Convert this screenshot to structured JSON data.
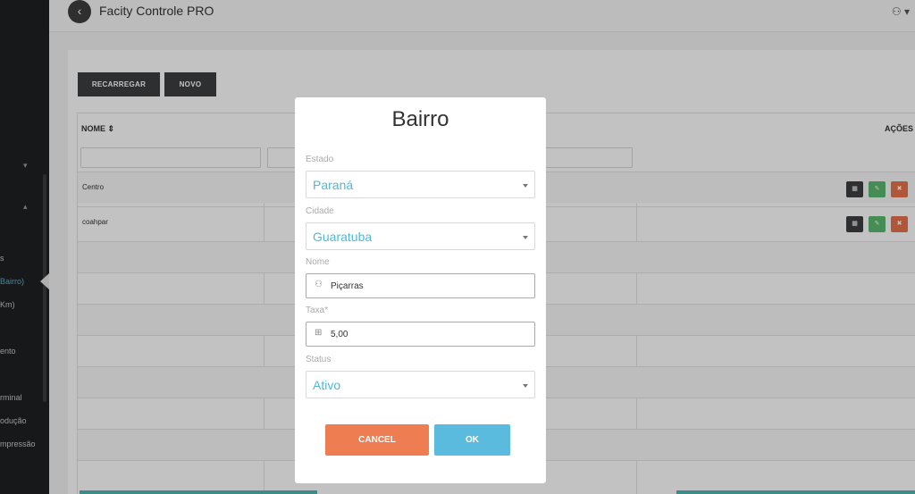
{
  "app": {
    "title": "Facity Controle PRO"
  },
  "sidebar": {
    "items": [
      {
        "label": "s"
      },
      {
        "label": "Bairro)"
      },
      {
        "label": "Km)"
      },
      {
        "label": "ento"
      },
      {
        "label": "rminal"
      },
      {
        "label": "odução"
      },
      {
        "label": "mpressão"
      }
    ]
  },
  "toolbar": {
    "reload_label": "RECARREGAR",
    "new_label": "NOVO"
  },
  "table": {
    "columns": {
      "name": "NOME ⇕",
      "actions": "AÇÕES"
    },
    "rows": [
      {
        "name": "Centro"
      },
      {
        "name": "coahpar"
      }
    ]
  },
  "modal": {
    "title": "Bairro",
    "estado": {
      "label": "Estado",
      "value": "Paraná"
    },
    "cidade": {
      "label": "Cidade",
      "value": "Guaratuba"
    },
    "nome": {
      "label": "Nome",
      "value": "Piçarras"
    },
    "taxa": {
      "label": "Taxa*",
      "value": "5,00"
    },
    "status": {
      "label": "Status",
      "value": "Ativo"
    },
    "cancel_label": "CANCEL",
    "ok_label": "OK"
  },
  "icons": {
    "back": "chevron-left-icon",
    "user": "user-icon",
    "person": "person-icon",
    "money": "money-icon"
  },
  "colors": {
    "accent": "#4fb8d6",
    "cancel": "#ee7d52",
    "ok": "#5bbbde",
    "edit": "#5bb970",
    "delete": "#e9734b",
    "dark": "#3d3f40"
  }
}
